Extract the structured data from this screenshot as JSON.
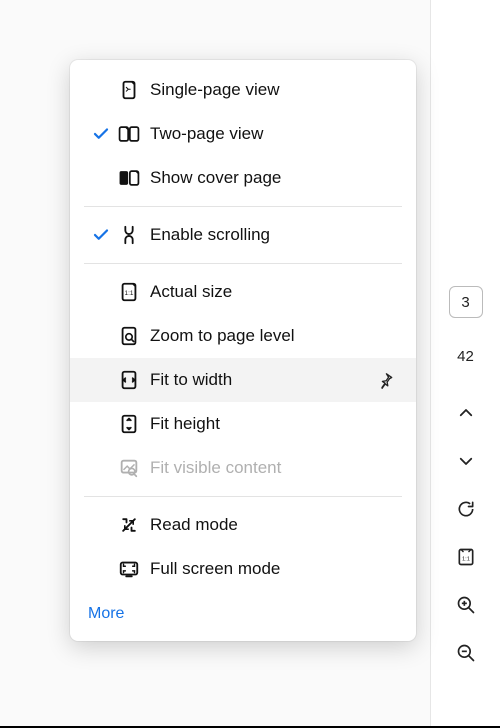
{
  "menu": {
    "items": [
      {
        "id": "single-page",
        "label": "Single-page view",
        "checked": false
      },
      {
        "id": "two-page",
        "label": "Two-page view",
        "checked": true
      },
      {
        "id": "cover-page",
        "label": "Show cover page",
        "checked": false
      }
    ],
    "scrolling": {
      "id": "enable-scrolling",
      "label": "Enable scrolling",
      "checked": true
    },
    "zoom": [
      {
        "id": "actual-size",
        "label": "Actual size"
      },
      {
        "id": "zoom-page-level",
        "label": "Zoom to page level"
      },
      {
        "id": "fit-width",
        "label": "Fit to width",
        "pinned": true,
        "hover": true
      },
      {
        "id": "fit-height",
        "label": "Fit height"
      },
      {
        "id": "fit-visible",
        "label": "Fit visible content",
        "disabled": true
      }
    ],
    "modes": [
      {
        "id": "read-mode",
        "label": "Read mode"
      },
      {
        "id": "full-screen",
        "label": "Full screen mode"
      }
    ],
    "more_label": "More"
  },
  "rail": {
    "page_current": "3",
    "page_total": "42"
  }
}
